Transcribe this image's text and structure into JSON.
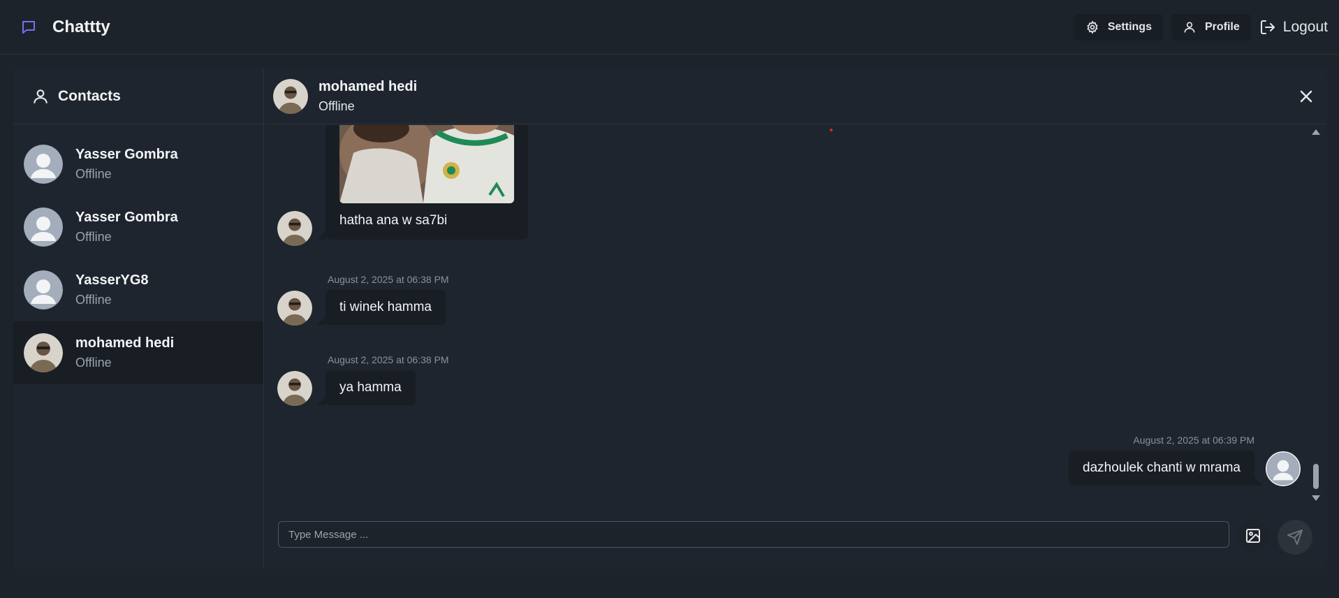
{
  "app": {
    "name": "Chattty"
  },
  "nav": {
    "settings_label": "Settings",
    "profile_label": "Profile",
    "logout_label": "Logout"
  },
  "sidebar": {
    "title": "Contacts",
    "contacts": [
      {
        "name": "Yasser Gombra",
        "status": "Offline",
        "avatar": "default-avatar"
      },
      {
        "name": "Yasser Gombra",
        "status": "Offline",
        "avatar": "default-avatar"
      },
      {
        "name": "YasserYG8",
        "status": "Offline",
        "avatar": "default-avatar"
      },
      {
        "name": "mohamed hedi",
        "status": "Offline",
        "avatar": "photo-avatar",
        "active": true
      }
    ]
  },
  "chat": {
    "contact_name": "mohamed hedi",
    "contact_status": "Offline",
    "messages": [
      {
        "side": "left",
        "type": "image",
        "caption": "hatha ana w sa7bi"
      },
      {
        "side": "left",
        "time": "August 2, 2025 at 06:38 PM",
        "text": "ti winek hamma"
      },
      {
        "side": "left",
        "time": "August 2, 2025 at 06:38 PM",
        "text": "ya hamma"
      },
      {
        "side": "right",
        "time": "August 2, 2025 at 06:39 PM",
        "text": "dazhoulek chanti w mrama"
      }
    ],
    "input_placeholder": "Type Message ..."
  },
  "colors": {
    "background": "#1d232a",
    "card": "#1f252e",
    "bubble": "#191e24",
    "brand_accent": "#7c6cf2"
  }
}
